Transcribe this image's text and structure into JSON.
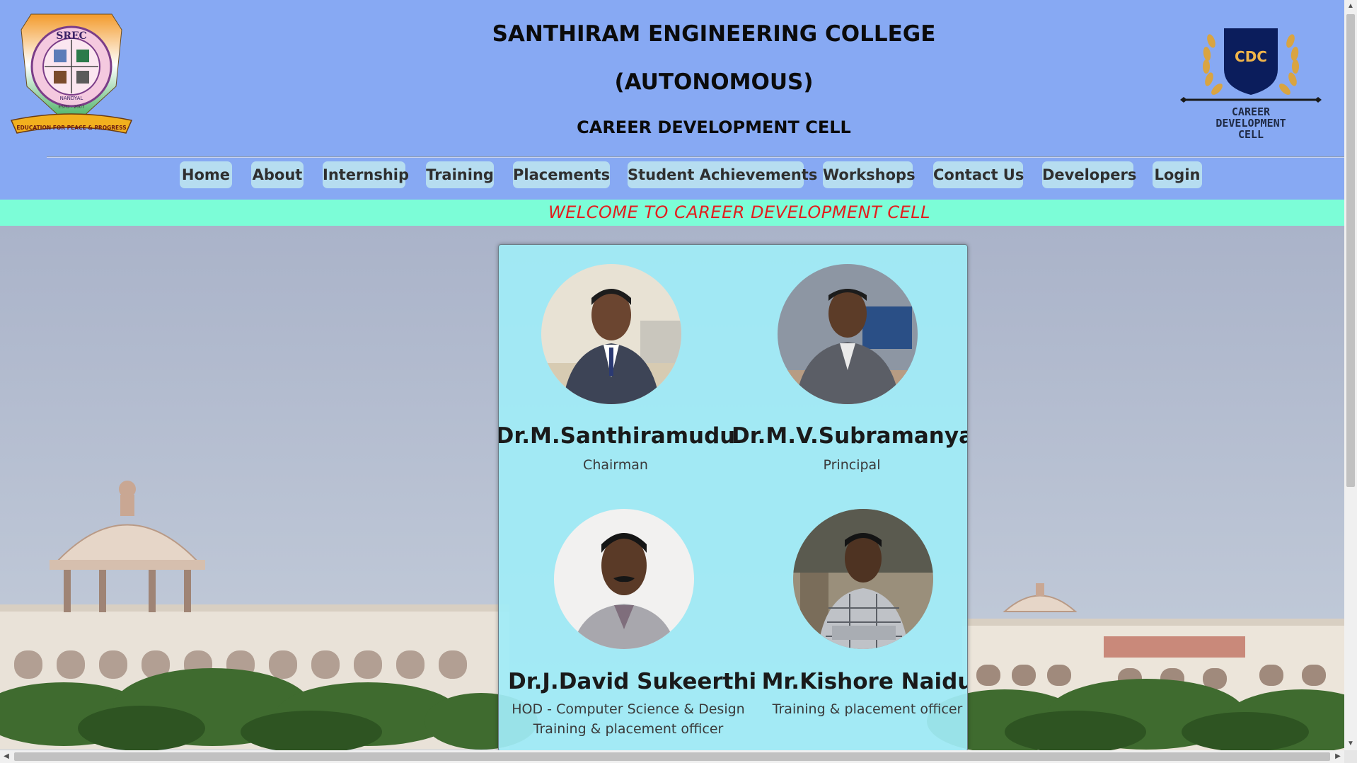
{
  "header": {
    "college_name": "SANTHIRAM ENGINEERING COLLEGE",
    "autonomous": "(AUTONOMOUS)",
    "cell_name": "CAREER DEVELOPMENT CELL",
    "left_logo": {
      "badge_text": "SREC",
      "place": "NANDYAL",
      "established": "ESTD - 2007",
      "motto": "EDUCATION FOR PEACE & PROGRESS"
    },
    "right_logo": {
      "badge_text": "CDC",
      "line1": "CAREER",
      "line2": "DEVELOPMENT",
      "line3": "CELL"
    }
  },
  "nav": [
    {
      "label": "Home"
    },
    {
      "label": "About"
    },
    {
      "label": "Internship"
    },
    {
      "label": "Training"
    },
    {
      "label": "Placements"
    },
    {
      "label": "Student Achievements"
    },
    {
      "label": "Workshops"
    },
    {
      "label": "Contact Us"
    },
    {
      "label": "Developers"
    },
    {
      "label": "Login"
    }
  ],
  "welcome": "WELCOME TO CAREER DEVELOPMENT CELL",
  "people": [
    {
      "name": "Dr.M.Santhiramudu",
      "role": "Chairman"
    },
    {
      "name": "Dr.M.V.Subramanyam",
      "role": "Principal"
    },
    {
      "name": "Dr.J.David Sukeerthi",
      "role": "HOD - Computer Science & Design",
      "role2": "Training & placement officer"
    },
    {
      "name": "Mr.Kishore Naidu",
      "role": "Training & placement officer"
    }
  ],
  "colors": {
    "header_bg": "#87a9f3",
    "nav_button_bg": "#b6ddf0",
    "marquee_bg": "#7cfdd7",
    "marquee_text": "#e31e1e",
    "card_bg": "#a0ecf6"
  }
}
